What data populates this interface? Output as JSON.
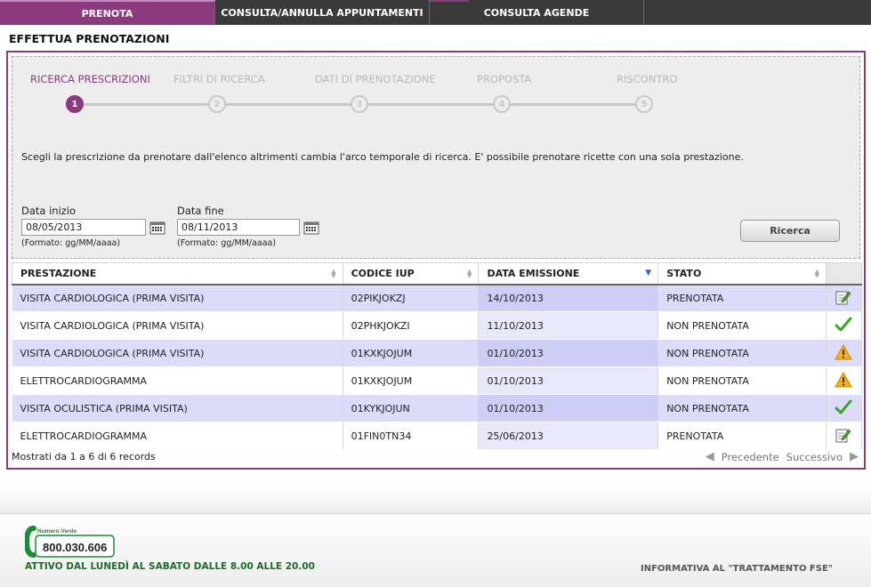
{
  "nav": {
    "tabs": [
      {
        "label": "PRENOTA",
        "active": true
      },
      {
        "label": "CONSULTA/ANNULLA APPUNTAMENTI",
        "active": false
      },
      {
        "label": "CONSULTA AGENDE",
        "active": false
      }
    ]
  },
  "page": {
    "title": "EFFETTUA PRENOTAZIONI"
  },
  "wizard": {
    "steps": [
      {
        "label": "RICERCA PRESCRIZIONI",
        "number": "1",
        "active": true
      },
      {
        "label": "FILTRI DI RICERCA",
        "number": "2",
        "active": false
      },
      {
        "label": "DATI DI PRENOTAZIONE",
        "number": "3",
        "active": false
      },
      {
        "label": "PROPOSTA",
        "number": "4",
        "active": false
      },
      {
        "label": "RISCONTRO",
        "number": "5",
        "active": false
      }
    ],
    "instructions": "Scegli la prescrizione da prenotare dall'elenco altrimenti cambia l'arco temporale di ricerca. E' possibile prenotare ricette con una sola prestazione."
  },
  "search": {
    "start_label": "Data inizio",
    "start_value": "08/05/2013",
    "start_format": "(Formato: gg/MM/aaaa)",
    "end_label": "Data fine",
    "end_value": "08/11/2013",
    "end_format": "(Formato: gg/MM/aaaa)",
    "button_label": "Ricerca"
  },
  "table": {
    "columns": [
      "PRESTAZIONE",
      "CODICE IUP",
      "DATA EMISSIONE",
      "STATO"
    ],
    "rows": [
      {
        "prestazione": "VISITA CARDIOLOGICA (PRIMA VISITA)",
        "codice": "02PIKJOKZJ",
        "data": "14/10/2013",
        "stato": "PRENOTATA",
        "icon": "edit-icon"
      },
      {
        "prestazione": "VISITA CARDIOLOGICA (PRIMA VISITA)",
        "codice": "02PHKJOKZI",
        "data": "11/10/2013",
        "stato": "NON PRENOTATA",
        "icon": "check-icon"
      },
      {
        "prestazione": "VISITA CARDIOLOGICA (PRIMA VISITA)",
        "codice": "01KXKJOJUM",
        "data": "01/10/2013",
        "stato": "NON PRENOTATA",
        "icon": "warning-icon"
      },
      {
        "prestazione": "ELETTROCARDIOGRAMMA",
        "codice": "01KXKJOJUM",
        "data": "01/10/2013",
        "stato": "NON PRENOTATA",
        "icon": "warning-icon"
      },
      {
        "prestazione": "VISITA OCULISTICA (PRIMA VISITA)",
        "codice": "01KYKJOJUN",
        "data": "01/10/2013",
        "stato": "NON PRENOTATA",
        "icon": "check-icon"
      },
      {
        "prestazione": "ELETTROCARDIOGRAMMA",
        "codice": "01FIN0TN34",
        "data": "25/06/2013",
        "stato": "PRENOTATA",
        "icon": "edit-icon"
      }
    ],
    "records_info": "Mostrati da 1 a 6 di 6 records",
    "prev_label": "Precedente",
    "next_label": "Successivo"
  },
  "footer": {
    "numero_verde_label": "Numero Verde",
    "phone": "800.030.606",
    "hours": "ATTIVO DAL LUNEDÌ AL SABATO DALLE 8.00 ALLE 20.00",
    "privacy_link": "INFORMATIVA AL \"TRATTAMENTO FSE\""
  },
  "colors": {
    "accent": "#8c3a7e",
    "nav_bg": "#3a3a3a",
    "row_highlight": "#dcdcfa",
    "footer_green": "#1e6b2e"
  }
}
